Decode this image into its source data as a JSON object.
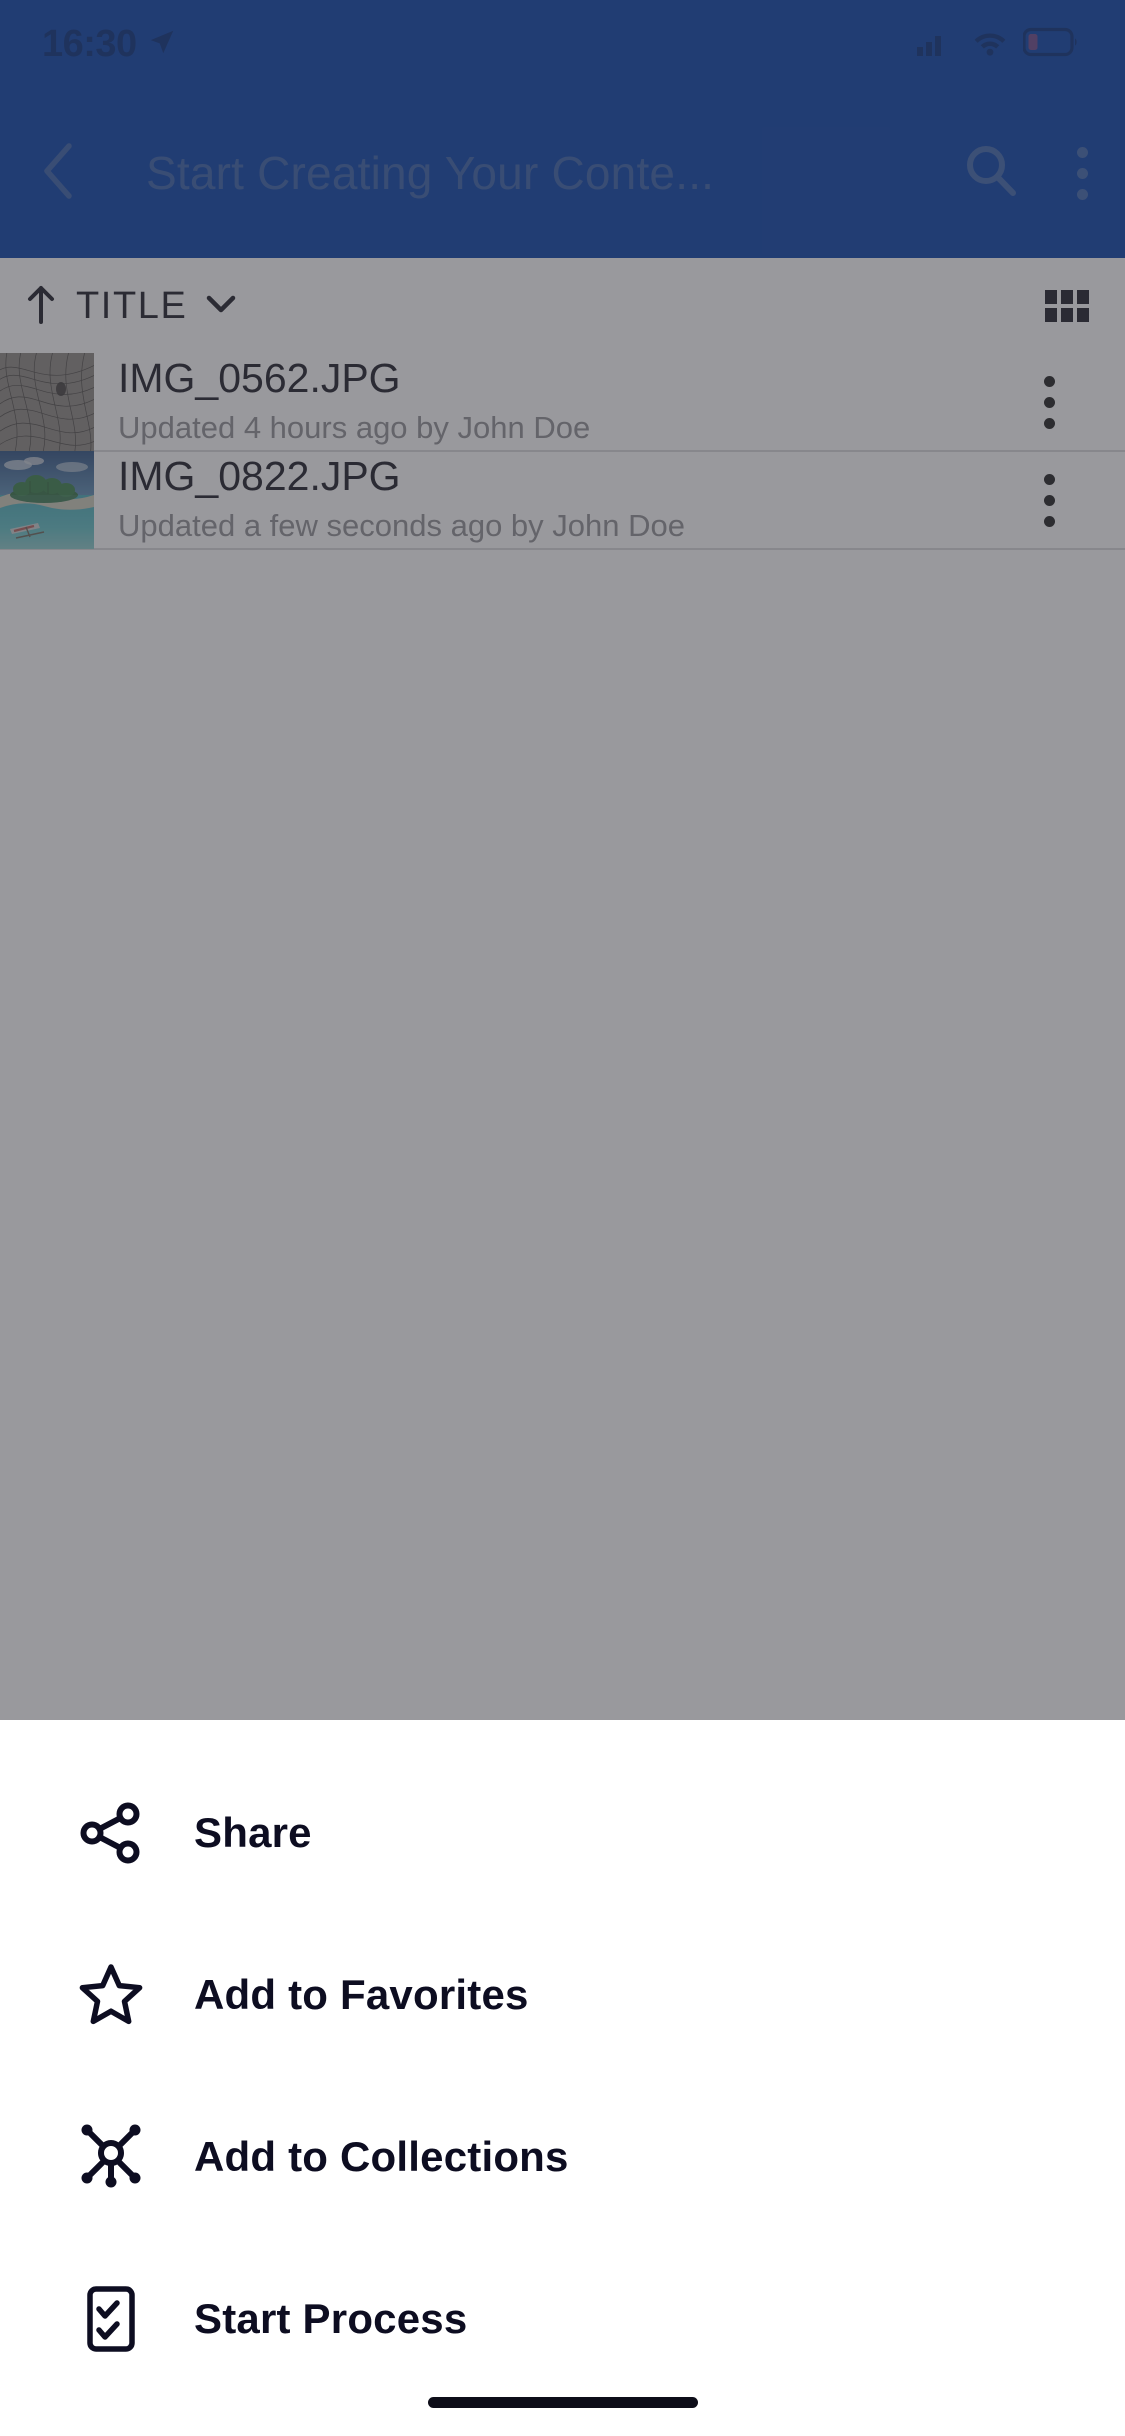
{
  "status_bar": {
    "time": "16:30",
    "location_icon": "location-arrow-icon",
    "cellular_icon": "cellular-bars-icon",
    "wifi_icon": "wifi-icon",
    "battery_icon": "battery-low-icon",
    "battery_color": "#FF4B3A",
    "bars_filled": 3,
    "bars_total": 4
  },
  "app_bar": {
    "back_icon": "chevron-left-icon",
    "title": "Start Creating Your Conte...",
    "search_icon": "search-icon",
    "overflow_icon": "more-vertical-icon",
    "background_color": "#163A80",
    "title_color": "#8C8A86"
  },
  "sort_bar": {
    "direction_icon": "arrow-up-icon",
    "sort_field": "TITLE",
    "dropdown_icon": "chevron-down-icon",
    "view_toggle_icon": "grid-view-icon"
  },
  "file_list": [
    {
      "thumbnail": "abstract-wireframe-thumbnail",
      "title": "IMG_0562.JPG",
      "subtitle": "Updated 4 hours ago by John Doe",
      "menu_icon": "more-vertical-icon"
    },
    {
      "thumbnail": "tropical-island-thumbnail",
      "title": "IMG_0822.JPG",
      "subtitle": "Updated a few seconds ago by John Doe",
      "menu_icon": "more-vertical-icon"
    }
  ],
  "action_sheet": {
    "items": [
      {
        "icon": "share-nodes-icon",
        "label": "Share"
      },
      {
        "icon": "star-outline-icon",
        "label": "Add to Favorites"
      },
      {
        "icon": "collections-hub-icon",
        "label": "Add to Collections"
      },
      {
        "icon": "checklist-clipboard-icon",
        "label": "Start Process"
      }
    ],
    "background_color": "#FFFFFF",
    "label_color": "#0D0D21"
  },
  "home_indicator": "home-indicator-bar"
}
